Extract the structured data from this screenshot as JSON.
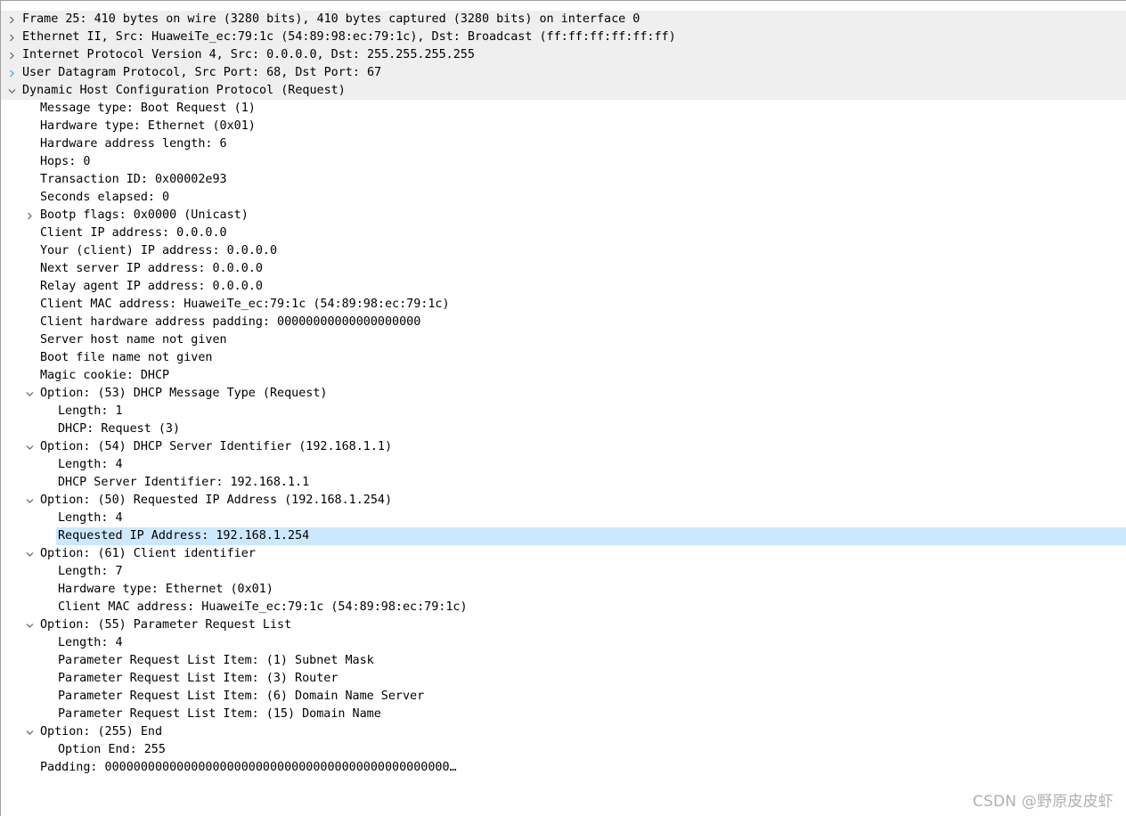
{
  "packet_details": {
    "rows": [
      {
        "level": 0,
        "expander": "collapsed",
        "text": "Frame 25: 410 bytes on wire (3280 bits), 410 bytes captured (3280 bits) on interface 0",
        "header": true
      },
      {
        "level": 0,
        "expander": "collapsed",
        "text": "Ethernet II, Src: HuaweiTe_ec:79:1c (54:89:98:ec:79:1c), Dst: Broadcast (ff:ff:ff:ff:ff:ff)",
        "header": true
      },
      {
        "level": 0,
        "expander": "collapsed",
        "text": "Internet Protocol Version 4, Src: 0.0.0.0, Dst: 255.255.255.255",
        "header": true
      },
      {
        "level": 0,
        "expander": "collapsed",
        "text": "User Datagram Protocol, Src Port: 68, Dst Port: 67",
        "header": true,
        "expander_color": "#3c9fd6"
      },
      {
        "level": 0,
        "expander": "expanded",
        "text": "Dynamic Host Configuration Protocol (Request)",
        "header": true
      },
      {
        "level": 1,
        "expander": "none",
        "text": "Message type: Boot Request (1)"
      },
      {
        "level": 1,
        "expander": "none",
        "text": "Hardware type: Ethernet (0x01)"
      },
      {
        "level": 1,
        "expander": "none",
        "text": "Hardware address length: 6"
      },
      {
        "level": 1,
        "expander": "none",
        "text": "Hops: 0"
      },
      {
        "level": 1,
        "expander": "none",
        "text": "Transaction ID: 0x00002e93"
      },
      {
        "level": 1,
        "expander": "none",
        "text": "Seconds elapsed: 0"
      },
      {
        "level": 1,
        "expander": "collapsed",
        "text": "Bootp flags: 0x0000 (Unicast)"
      },
      {
        "level": 1,
        "expander": "none",
        "text": "Client IP address: 0.0.0.0"
      },
      {
        "level": 1,
        "expander": "none",
        "text": "Your (client) IP address: 0.0.0.0"
      },
      {
        "level": 1,
        "expander": "none",
        "text": "Next server IP address: 0.0.0.0"
      },
      {
        "level": 1,
        "expander": "none",
        "text": "Relay agent IP address: 0.0.0.0"
      },
      {
        "level": 1,
        "expander": "none",
        "text": "Client MAC address: HuaweiTe_ec:79:1c (54:89:98:ec:79:1c)"
      },
      {
        "level": 1,
        "expander": "none",
        "text": "Client hardware address padding: 00000000000000000000"
      },
      {
        "level": 1,
        "expander": "none",
        "text": "Server host name not given"
      },
      {
        "level": 1,
        "expander": "none",
        "text": "Boot file name not given"
      },
      {
        "level": 1,
        "expander": "none",
        "text": "Magic cookie: DHCP"
      },
      {
        "level": 1,
        "expander": "expanded",
        "text": "Option: (53) DHCP Message Type (Request)"
      },
      {
        "level": 2,
        "expander": "none",
        "text": "Length: 1"
      },
      {
        "level": 2,
        "expander": "none",
        "text": "DHCP: Request (3)"
      },
      {
        "level": 1,
        "expander": "expanded",
        "text": "Option: (54) DHCP Server Identifier (192.168.1.1)"
      },
      {
        "level": 2,
        "expander": "none",
        "text": "Length: 4"
      },
      {
        "level": 2,
        "expander": "none",
        "text": "DHCP Server Identifier: 192.168.1.1"
      },
      {
        "level": 1,
        "expander": "expanded",
        "text": "Option: (50) Requested IP Address (192.168.1.254)"
      },
      {
        "level": 2,
        "expander": "none",
        "text": "Length: 4"
      },
      {
        "level": 2,
        "expander": "none",
        "text": "Requested IP Address: 192.168.1.254",
        "selected": true
      },
      {
        "level": 1,
        "expander": "expanded",
        "text": "Option: (61) Client identifier"
      },
      {
        "level": 2,
        "expander": "none",
        "text": "Length: 7"
      },
      {
        "level": 2,
        "expander": "none",
        "text": "Hardware type: Ethernet (0x01)"
      },
      {
        "level": 2,
        "expander": "none",
        "text": "Client MAC address: HuaweiTe_ec:79:1c (54:89:98:ec:79:1c)"
      },
      {
        "level": 1,
        "expander": "expanded",
        "text": "Option: (55) Parameter Request List"
      },
      {
        "level": 2,
        "expander": "none",
        "text": "Length: 4"
      },
      {
        "level": 2,
        "expander": "none",
        "text": "Parameter Request List Item: (1) Subnet Mask"
      },
      {
        "level": 2,
        "expander": "none",
        "text": "Parameter Request List Item: (3) Router"
      },
      {
        "level": 2,
        "expander": "none",
        "text": "Parameter Request List Item: (6) Domain Name Server"
      },
      {
        "level": 2,
        "expander": "none",
        "text": "Parameter Request List Item: (15) Domain Name"
      },
      {
        "level": 1,
        "expander": "expanded",
        "text": "Option: (255) End"
      },
      {
        "level": 2,
        "expander": "none",
        "text": "Option End: 255"
      },
      {
        "level": 1,
        "expander": "none",
        "text": "Padding: 000000000000000000000000000000000000000000000000…"
      }
    ]
  },
  "watermark": {
    "text": "CSDN @野原皮皮虾"
  },
  "colors": {
    "header_row_bg": "#efefef",
    "selected_row_bg": "#cce8ff",
    "expander_arrow": "#606060"
  }
}
